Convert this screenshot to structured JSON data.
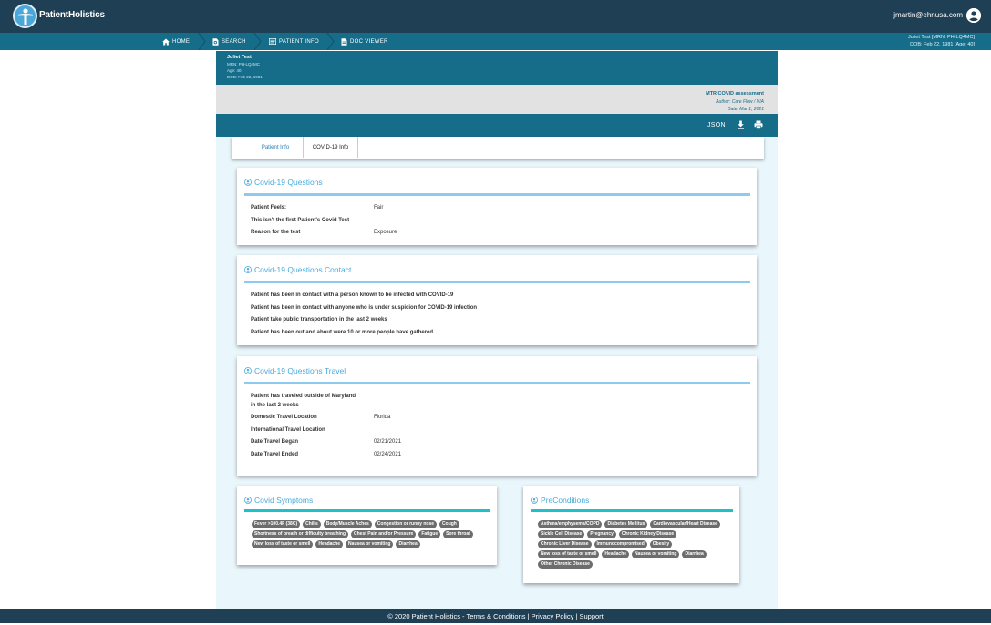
{
  "app": {
    "brand": "PatientHolistics",
    "user_email": "jmartin@ehnusa.com",
    "icons": [
      "logo-icon",
      "account-icon"
    ]
  },
  "nav": {
    "items": [
      {
        "label": "HOME",
        "icon": "home-icon"
      },
      {
        "label": "SEARCH",
        "icon": "search-doc-icon"
      },
      {
        "label": "PATIENT INFO",
        "icon": "patient-info-icon"
      },
      {
        "label": "DOC VIEWER",
        "icon": "doc-icon"
      }
    ],
    "patient_line1": "Juliet Test [MRN: PH-LQ4MC]",
    "patient_line2": "DOB: Feb 22, 1981 [Age: 40]"
  },
  "patient": {
    "name": "Juliet Test",
    "mrn": "MRN: PH-LQ4MC",
    "age": "Age: 40",
    "dob": "DOB: Feb 22, 1981"
  },
  "document": {
    "title": "MTR COVID assessment",
    "author": "Author: Care Flow / N/A",
    "date": "Date: Mar 1, 2021",
    "json_label": "JSON"
  },
  "tabs": [
    {
      "label": "Patient Info",
      "active": false
    },
    {
      "label": "COVID-19 Info",
      "active": true
    }
  ],
  "sections": {
    "questions": {
      "title": "Covid-19 Questions",
      "rows": [
        {
          "label": "Patient Feels:",
          "value": "Fair"
        },
        {
          "label": "This isn't the first Patient's Covid Test",
          "value": ""
        },
        {
          "label": "Reason for the test",
          "value": "Exposure"
        }
      ]
    },
    "contact": {
      "title": "Covid-19 Questions Contact",
      "rows": [
        "Patient has been in contact with a person known to be infected with COVID-19",
        "Patient has been in contact with anyone who is under suspicion for COVID-19 infection",
        "Patient take public transportation in the last 2 weeks",
        "Patient has been out and about were 10 or more people have gathered"
      ]
    },
    "travel": {
      "title": "Covid-19 Questions Travel",
      "rows": [
        {
          "label1": "Patient has traveled outside of Maryland",
          "label2": "in the last 2 weeks",
          "value": ""
        },
        {
          "label": "Domestic Travel Location",
          "value": "Florida"
        },
        {
          "label": "International Travel Location",
          "value": ""
        },
        {
          "label": "Date Travel Began",
          "value": "02/21/2021"
        },
        {
          "label": "Date Travel Ended",
          "value": "02/24/2021"
        }
      ]
    },
    "symptoms": {
      "title": "Covid Symptoms",
      "chips": [
        "Fever >100.4F (38C)",
        "Chills",
        "Body/Muscle Aches",
        "Congestion or runny nose",
        "Cough",
        "Shortness of breath or difficulty breathing",
        "Chest Pain and/or Pressure",
        "Fatigue",
        "Sore throat",
        "New loss of taste or smell",
        "Headache",
        "Nausea or vomiting",
        "Diarrhea"
      ]
    },
    "preconditions": {
      "title": "PreConditions",
      "chips": [
        "Asthma/emphysema/COPD",
        "Diabetes Mellitus",
        "Cardiovascular/Heart Disease",
        "Sickle Cell Disease",
        "Pregnancy",
        "Chronic Kidney Disease",
        "Chronic Liver Disease",
        "Immunocompromised",
        "Obesity",
        "New loss of taste or smell",
        "Headache",
        "Nausea or vomiting",
        "Diarrhea",
        "Other Chronic Disease"
      ]
    }
  },
  "footer": {
    "copyright": "© 2020 Patient Holistics",
    "sep1": " - ",
    "terms": "Terms & Conditions",
    "sep2": " | ",
    "privacy": "Privacy Policy",
    "sep3": " | ",
    "support": "Support"
  },
  "colors": {
    "topbar": "#1f3f55",
    "nav": "#156d8a",
    "accent": "#48a9dc",
    "section_rule": "#8ccaf0",
    "chip_rule": "#1fc1c9",
    "chip": "#6d6d6d"
  }
}
